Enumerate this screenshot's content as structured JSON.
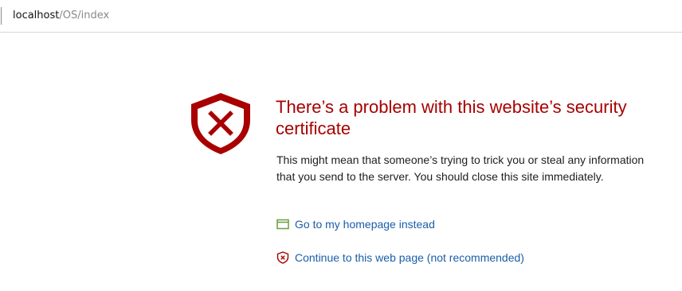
{
  "address_bar": {
    "host": "localhost",
    "path": "/OS/index"
  },
  "error_page": {
    "icon": "shield-error-icon",
    "heading": "There’s a problem with this website’s security certificate",
    "message": "This might mean that someone’s trying to trick you or steal any information that you send to the server. You should close this site immediately.",
    "links": {
      "homepage": {
        "label": "Go to my homepage instead",
        "icon": "homepage-icon",
        "icon_color": "#6a9f3c"
      },
      "continue": {
        "label": "Continue to this web page (not recommended)",
        "icon": "shield-warning-icon",
        "icon_color": "#a80000"
      }
    }
  },
  "colors": {
    "heading": "#a80000",
    "link": "#1a5ea8",
    "shield": "#a80000"
  }
}
